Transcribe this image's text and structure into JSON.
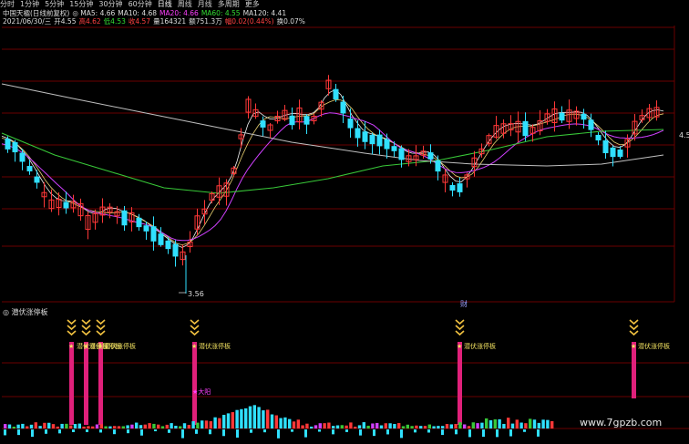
{
  "toolbar": {
    "tabs": [
      "分时",
      "1分钟",
      "5分钟",
      "15分钟",
      "30分钟",
      "60分钟",
      "日线",
      "周线",
      "月线",
      "多周期",
      "更多"
    ],
    "active": "日线"
  },
  "header": {
    "line1": [
      {
        "t": "中国天楹(日线前复权)",
        "c": "#dddddd"
      },
      {
        "t": "◎ MA5: 4.66",
        "c": "#dddddd"
      },
      {
        "t": "MA10: 4.68",
        "c": "#dddddd"
      },
      {
        "t": "MA20: 4.66",
        "c": "#ff40ff"
      },
      {
        "t": "MA60: 4.55",
        "c": "#33dd33"
      },
      {
        "t": "MA120: 4.41",
        "c": "#dddddd"
      }
    ],
    "line2": [
      {
        "t": "2021/06/30/三",
        "c": "#dddddd"
      },
      {
        "t": "开4.55",
        "c": "#dddddd"
      },
      {
        "t": "高4.62",
        "c": "#ff4040"
      },
      {
        "t": "低4.53",
        "c": "#33dd33"
      },
      {
        "t": "收4.57",
        "c": "#ff4040"
      },
      {
        "t": "量164321",
        "c": "#dddddd"
      },
      {
        "t": "额751.3万",
        "c": "#dddddd"
      },
      {
        "t": "幅0.02(0.44%)",
        "c": "#ff4040"
      },
      {
        "t": "换0.07%",
        "c": "#dddddd"
      }
    ]
  },
  "indicator": {
    "title": "◎ 潜伏涨停板",
    "label": "★潜伏涨停板",
    "fire_label": "★大阳"
  },
  "watermark": "www.7gpzb.com",
  "chart_data": {
    "type": "candlestick",
    "price_labels": {
      "low": "3.56",
      "current": "4.5"
    },
    "marker": "财",
    "volume_bars": 126,
    "signals_at_candles": [
      6,
      7,
      8,
      17,
      41,
      56
    ]
  },
  "colors": {
    "up": "#ff3838",
    "down": "#30e0ff",
    "ma20": "#d040ff",
    "ma60": "#38c838",
    "ma120": "#c0c0c0",
    "ma5": "#f0f0f0",
    "ma10": "#e8d070",
    "signal": "#e0207a",
    "grid": "#6a0000"
  }
}
